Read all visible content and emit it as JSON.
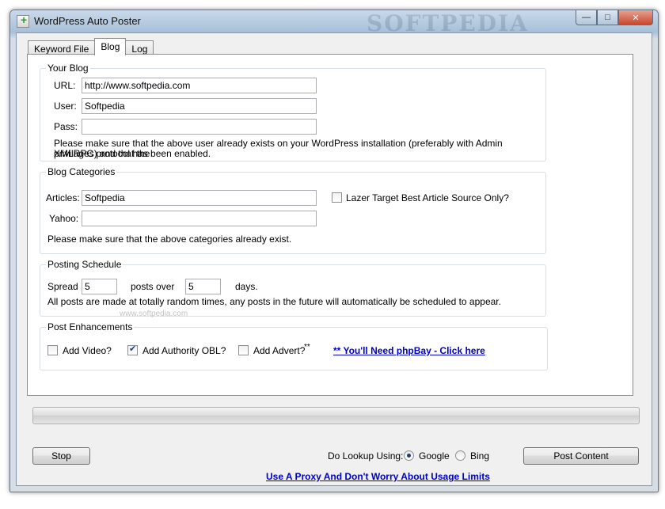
{
  "window": {
    "title": "WordPress Auto Poster",
    "watermark": "SOFTPEDIA"
  },
  "tabs": [
    {
      "label": "Keyword File",
      "active": false
    },
    {
      "label": "Blog",
      "active": true
    },
    {
      "label": "Log",
      "active": false
    }
  ],
  "your_blog": {
    "title": "Your Blog",
    "url_label": "URL:",
    "url_value": "http://www.softpedia.com",
    "user_label": "User:",
    "user_value": "Softpedia",
    "pass_label": "Pass:",
    "pass_value": "",
    "note_line1": "Please make sure that the above user already exists on your WordPress installation (preferably with Admin privilages) and that the",
    "note_line2": "XMLRPC protocol has been enabled."
  },
  "blog_categories": {
    "title": "Blog Categories",
    "articles_label": "Articles:",
    "articles_value": "Softpedia",
    "yahoo_label": "Yahoo:",
    "yahoo_value": "",
    "lazer_label": "Lazer Target Best Article Source Only?",
    "lazer_checked": false,
    "note": "Please make sure that the above categories already exist."
  },
  "posting_schedule": {
    "title": "Posting Schedule",
    "spread_label": "Spread",
    "spread_value": "5",
    "posts_over_label": "posts over",
    "days_value": "5",
    "days_label": "days.",
    "note": "All posts are made at totally random times, any posts in the future will automatically be scheduled to appear.",
    "watermark": "www.softpedia.com"
  },
  "post_enhancements": {
    "title": "Post Enhancements",
    "video_label": "Add Video?",
    "video_checked": false,
    "authority_label": "Add Authority OBL?",
    "authority_checked": true,
    "advert_label": "Add Advert?",
    "advert_suffix": "**",
    "advert_checked": false,
    "phpbay_link": "** You'll Need phpBay - Click here"
  },
  "progress": {
    "value": 0
  },
  "bottom": {
    "stop_button": "Stop",
    "lookup_label": "Do Lookup Using:",
    "google_label": "Google",
    "bing_label": "Bing",
    "selected_engine": "Google",
    "post_button": "Post Content",
    "proxy_link": "Use A Proxy And Don't Worry About Usage Limits"
  }
}
